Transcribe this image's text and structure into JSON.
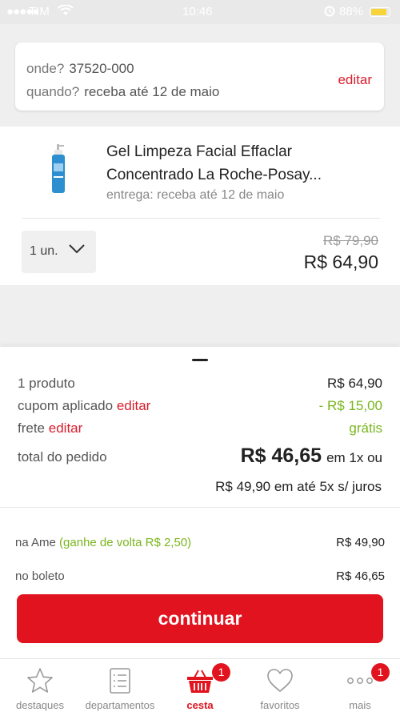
{
  "status_bar": {
    "carrier": "TIM",
    "time": "10:46",
    "battery": "88%"
  },
  "location": {
    "where_key": "onde?",
    "where_value": "37520-000",
    "when_key": "quando?",
    "when_value": "receba até 12 de maio",
    "edit_label": "editar"
  },
  "product": {
    "title": "Gel Limpeza Facial Effaclar Concentrado La Roche-Posay...",
    "delivery": "entrega: receba até 12 de maio",
    "quantity": "1 un.",
    "old_price": "R$ 79,90",
    "price": "R$ 64,90"
  },
  "summary": {
    "products_label": "1 produto",
    "products_value": "R$ 64,90",
    "coupon_label": "cupom aplicado",
    "coupon_edit": "editar",
    "coupon_value": "- R$ 15,00",
    "shipping_label": "frete",
    "shipping_edit": "editar",
    "shipping_value": "grátis",
    "total_label": "total do pedido",
    "total_value": "R$ 46,65",
    "total_suffix": "em 1x ou",
    "installments": "R$ 49,90 em até 5x s/ juros"
  },
  "payment": {
    "ame_label": "na Ame",
    "ame_cashback": "(ganhe de volta R$ 2,50)",
    "ame_value": "R$ 49,90",
    "boleto_label": "no boleto",
    "boleto_value": "R$ 46,65"
  },
  "continue_label": "continuar",
  "nav": [
    {
      "label": "destaques",
      "icon": "star-icon"
    },
    {
      "label": "departamentos",
      "icon": "list-icon"
    },
    {
      "label": "cesta",
      "icon": "basket-icon",
      "badge": "1",
      "active": true
    },
    {
      "label": "favoritos",
      "icon": "heart-icon"
    },
    {
      "label": "mais",
      "icon": "more-icon",
      "badge": "1"
    }
  ],
  "colors": {
    "brand_red": "#e1131f",
    "green": "#7ab51d"
  }
}
